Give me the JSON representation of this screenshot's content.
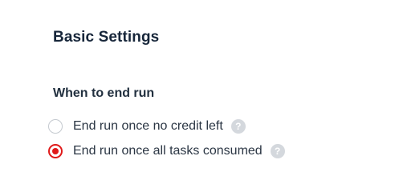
{
  "settings": {
    "title": "Basic Settings",
    "end_run": {
      "label": "When to end run",
      "options": [
        {
          "label": "End run once no credit left",
          "checked": false,
          "help_icon": "help-icon"
        },
        {
          "label": "End run once all tasks consumed",
          "checked": true,
          "help_icon": "help-icon"
        }
      ]
    }
  },
  "help_glyph": "?",
  "colors": {
    "accent": "#e01a1a",
    "title": "#17263a",
    "text": "#2b3644",
    "help_icon_bg": "#d4d8dd",
    "radio_border": "#c4c9cf"
  }
}
